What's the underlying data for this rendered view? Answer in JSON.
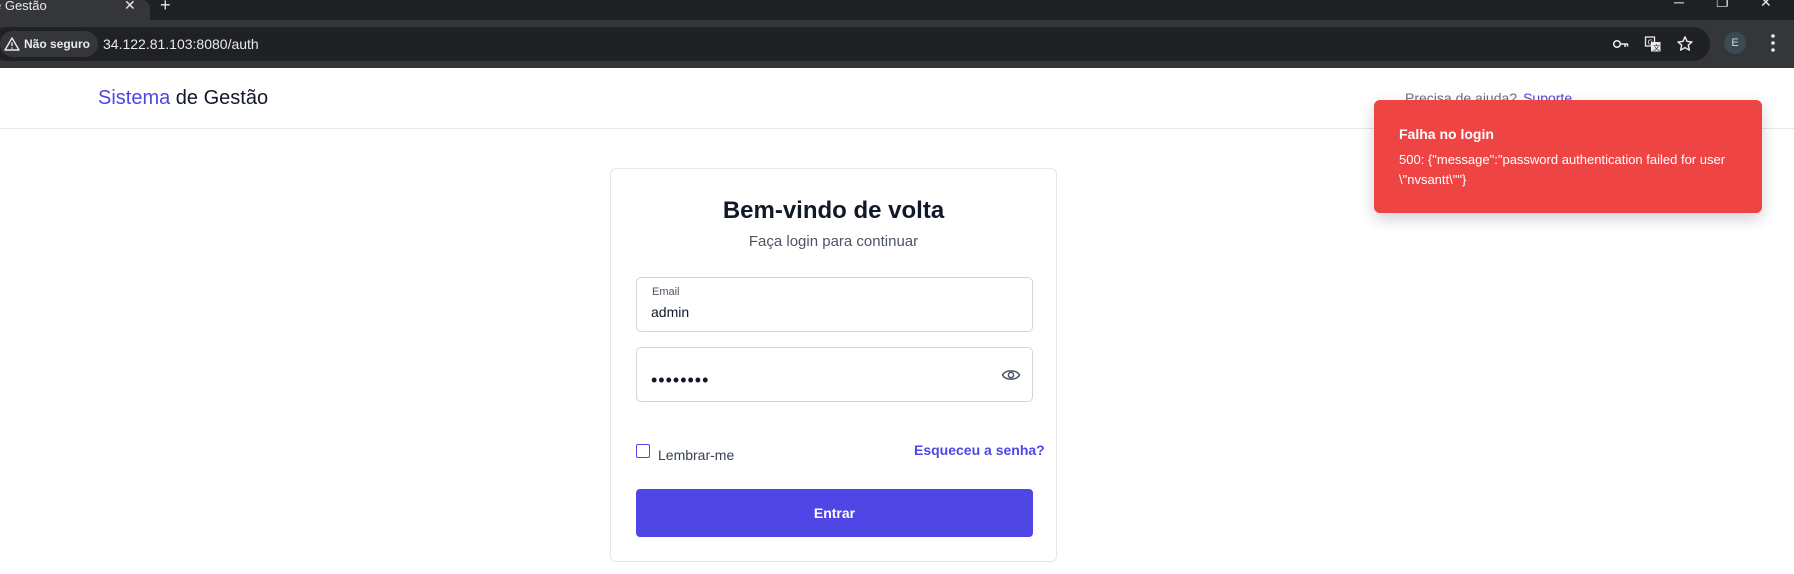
{
  "browser": {
    "tab_title": "e Gestão",
    "security_label": "Não seguro",
    "url": "34.122.81.103:8080/auth",
    "profile_initial": "E"
  },
  "header": {
    "brand_accent": "Sistema",
    "brand_rest": " de Gestão",
    "help_text": "Precisa de ajuda?",
    "help_link": "Suporte"
  },
  "toast": {
    "title": "Falha no login",
    "message": "500: {\"message\":\"password authentication failed for user \\\"nvsantt\\\"\"}"
  },
  "login": {
    "title": "Bem-vindo de volta",
    "subtitle": "Faça login para continuar",
    "email_label": "Email",
    "email_value": "admin",
    "password_value": "••••••••",
    "remember_label": "Lembrar-me",
    "remember_checked": false,
    "forgot_link": "Esqueceu a senha?",
    "submit_label": "Entrar"
  },
  "colors": {
    "accent": "#4f46e5",
    "toast_bg": "#ef4444",
    "chrome_bg": "#35363a"
  }
}
